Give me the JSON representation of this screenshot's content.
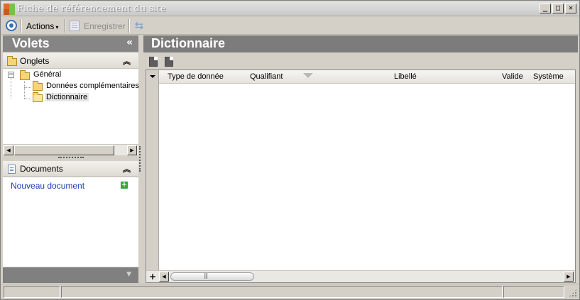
{
  "window": {
    "title": "Fiche de référencement du site",
    "buttons": {
      "minimize": "_",
      "maximize": "□",
      "close": "✕"
    }
  },
  "toolbar": {
    "actions_label": "Actions",
    "actions_caret": "▾",
    "save_label": "Enregistrer",
    "refresh_glyph": "⇆"
  },
  "left_panel": {
    "title": "Volets",
    "collapse_glyph": "«",
    "onglets_section": {
      "label": "Onglets",
      "chevron": "︽"
    },
    "tree": {
      "root": {
        "label": "Général",
        "expander": "−"
      },
      "children": [
        {
          "label": "Données complémentaires"
        },
        {
          "label": "Dictionnaire",
          "selected": true
        }
      ]
    },
    "scroll": {
      "left": "◀",
      "right": "▶"
    },
    "documents_section": {
      "label": "Documents",
      "chevron": "︽"
    },
    "new_document_link": "Nouveau document",
    "new_document_plus": "+",
    "footer_chevron": "▼"
  },
  "main": {
    "title": "Dictionnaire",
    "grid": {
      "columns": [
        "Type de donnée",
        "Qualifiant",
        "Libellé",
        "Valide",
        "Système"
      ],
      "rows": [],
      "footer": {
        "add": "+",
        "left": "◀",
        "right": "▶"
      }
    }
  },
  "statusbar": {
    "cells": [
      "",
      "",
      ""
    ]
  }
}
